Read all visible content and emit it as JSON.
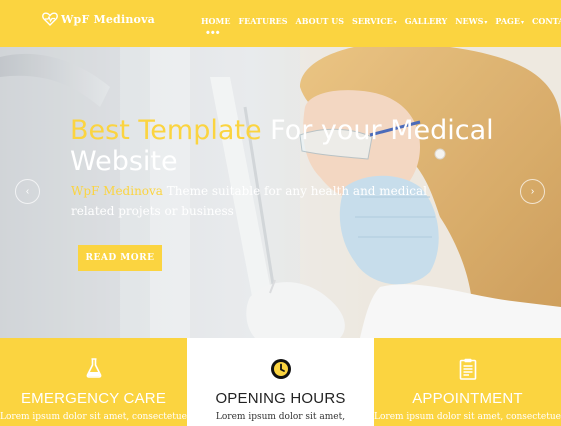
{
  "brand": {
    "logo_text": "WpF Medinova",
    "logo_icon": "heart-pulse-icon"
  },
  "nav": {
    "items": [
      {
        "label": "HOME"
      },
      {
        "label": "FEATURES"
      },
      {
        "label": "ABOUT US"
      },
      {
        "label": "SERVICE",
        "caret": "▾"
      },
      {
        "label": "GALLERY"
      },
      {
        "label": "NEWS",
        "caret": "▾"
      },
      {
        "label": "PAGE",
        "caret": "▾"
      },
      {
        "label": "CONTACT"
      }
    ],
    "more": "•••"
  },
  "hero": {
    "title_accent": "Best Template",
    "title_rest": " For your Medical",
    "title_line2": "Website",
    "subtitle_brand": "WpF Medinova",
    "subtitle_rest": " Theme suitable for any health and medical related projets or business",
    "button_label": "READ MORE",
    "prev_arrow": "‹",
    "next_arrow": "›"
  },
  "features": [
    {
      "title": "EMERGENCY CARE",
      "text": "Lorem ipsum dolor sit amet, consectetuer",
      "icon": "flask-icon"
    },
    {
      "title": "OPENING HOURS",
      "text": "Lorem ipsum dolor sit amet,",
      "icon": "clock-icon"
    },
    {
      "title": "APPOINTMENT",
      "text": "Lorem ipsum dolor sit amet, consectetuer",
      "icon": "clipboard-icon"
    }
  ],
  "colors": {
    "accent": "#fbd440",
    "white": "#ffffff",
    "dark_text": "#222222"
  }
}
